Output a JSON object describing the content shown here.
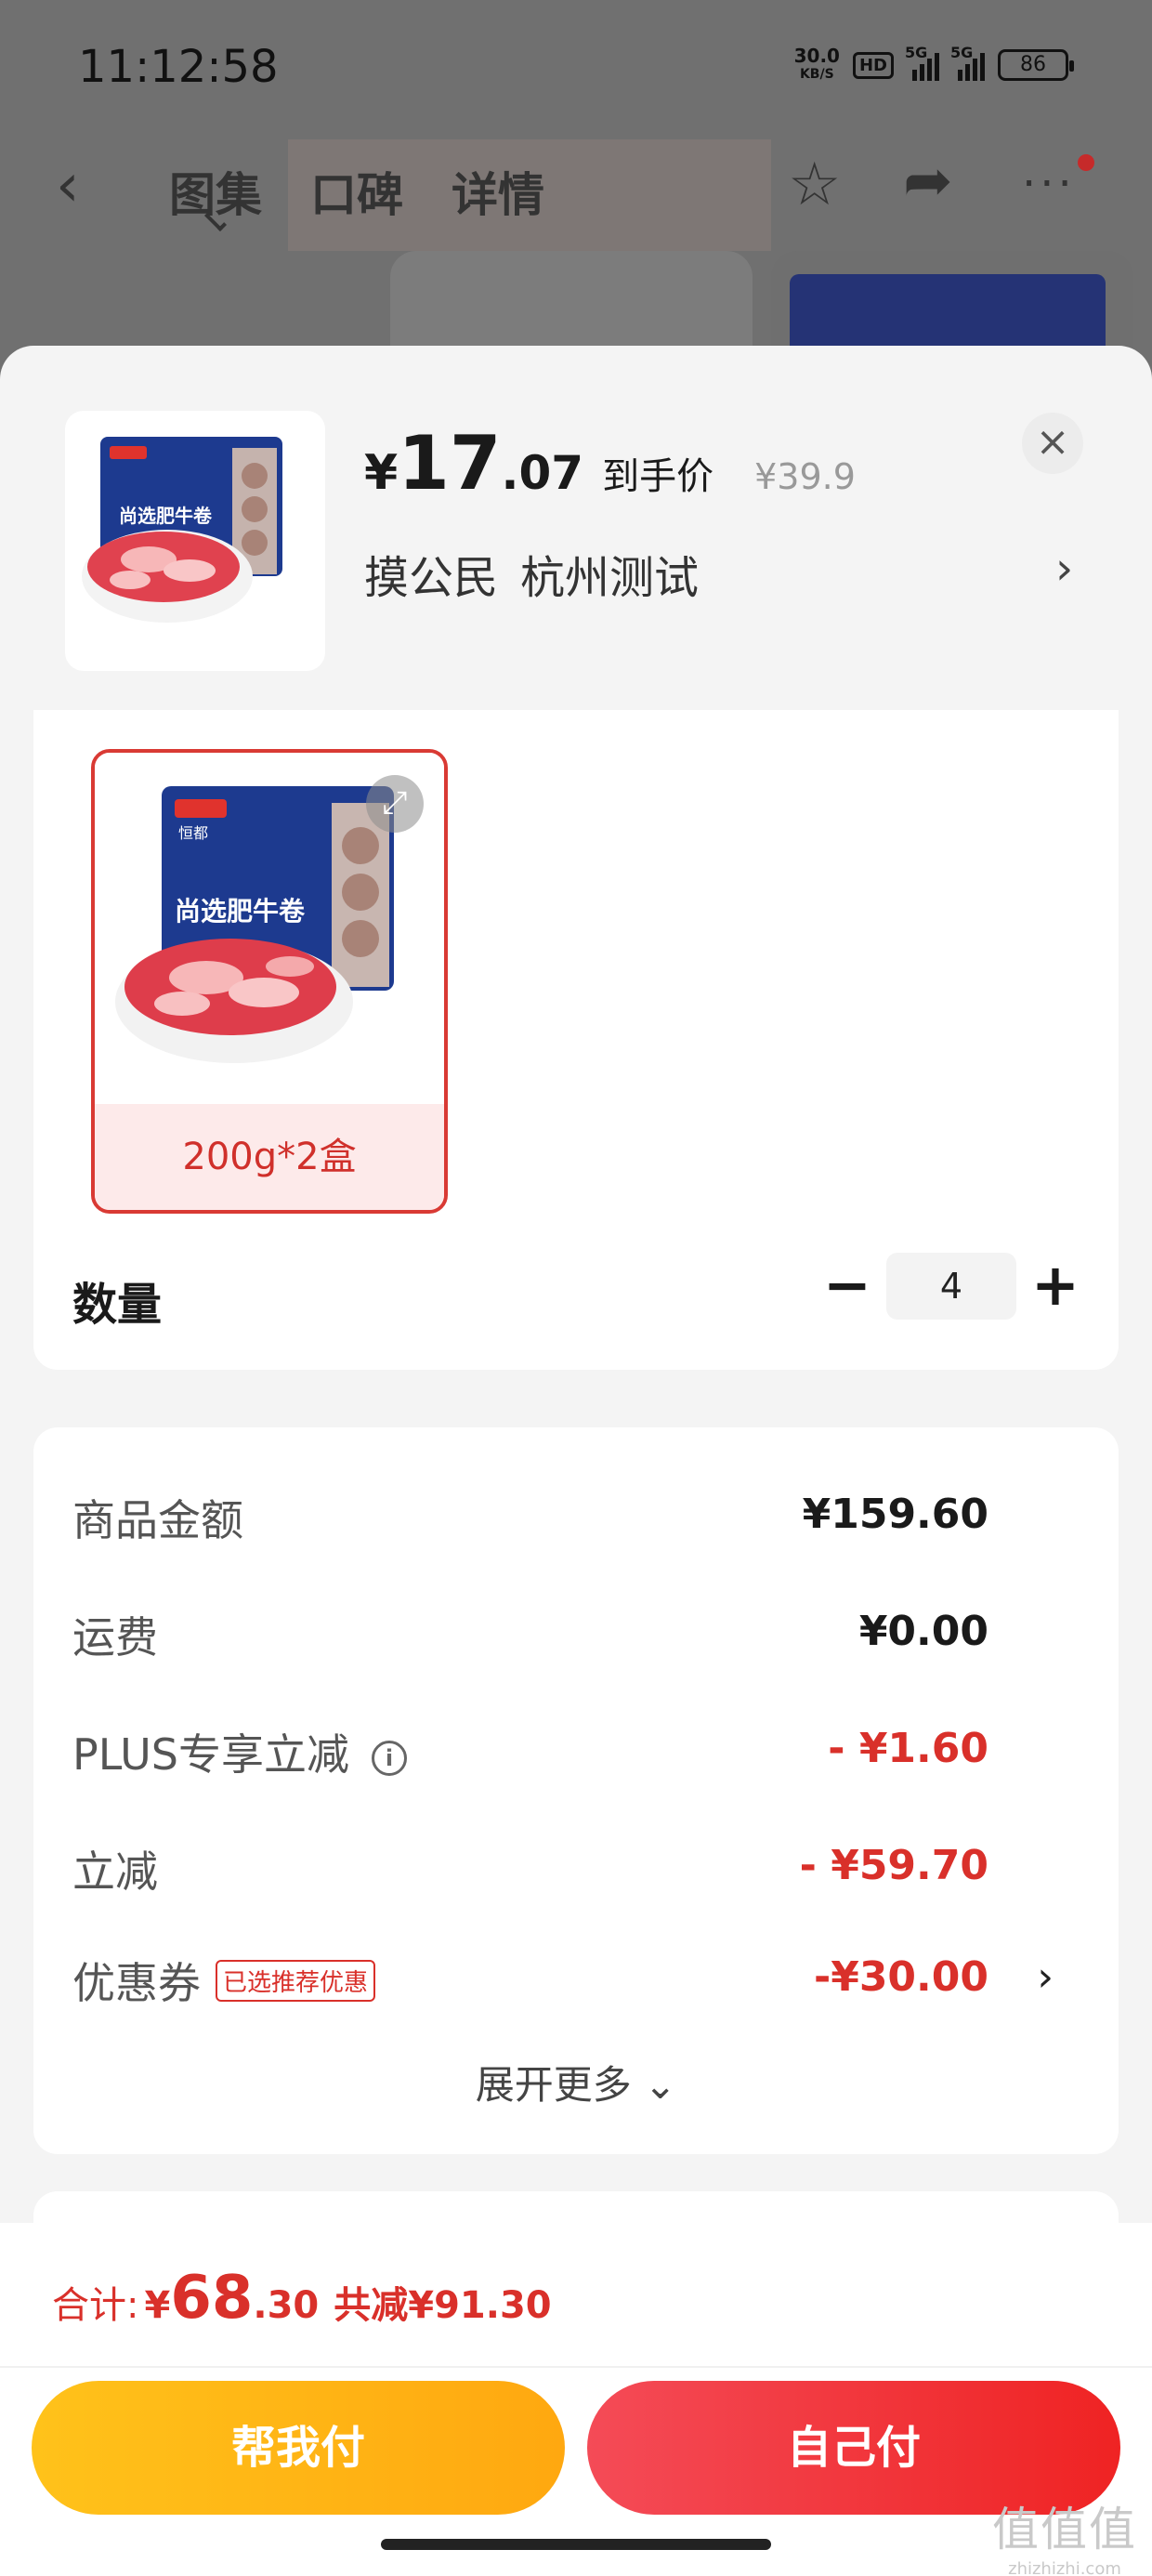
{
  "status_bar": {
    "time": "11:12:58",
    "net_speed": "30.0",
    "net_unit": "KB/S",
    "hd": "HD",
    "signal1": "5G",
    "signal2": "5G",
    "battery": "86"
  },
  "nav": {
    "tabs": [
      "图集",
      "口碑",
      "详情"
    ]
  },
  "product": {
    "price_symbol": "¥",
    "price_int": "17",
    "price_dec": ".07",
    "price_tag": "到手价",
    "original_price": "¥39.9",
    "shop_name": "摸公民",
    "shop_location": "杭州测试",
    "package_brand": "恒都",
    "package_title": "尚选肥牛卷"
  },
  "sku": {
    "options": [
      {
        "label": "200g*2盒",
        "selected": true
      }
    ]
  },
  "quantity": {
    "label": "数量",
    "value": "4"
  },
  "price_breakdown": {
    "rows": [
      {
        "label": "商品金额",
        "value": "¥159.60"
      },
      {
        "label": "运费",
        "value": "¥0.00"
      },
      {
        "label": "PLUS专享立减",
        "value": "- ¥1.60"
      },
      {
        "label": "立减",
        "value": "- ¥59.70"
      },
      {
        "label": "优惠券",
        "badge": "已选推荐优惠",
        "value": "-¥30.00"
      }
    ],
    "expand_label": "展开更多"
  },
  "footer": {
    "total_label": "合计:",
    "total_yen": "¥",
    "total_int": "68",
    "total_dec": ".30",
    "total_saving": "共减¥91.30",
    "help_pay_label": "帮我付",
    "self_pay_label": "自己付"
  },
  "watermark": {
    "text": "值值值",
    "site": "zhizhizhi.com"
  },
  "colors": {
    "accent_red": "#d9302a",
    "help_button": "#ffb515",
    "self_button": "#f23a3e"
  }
}
